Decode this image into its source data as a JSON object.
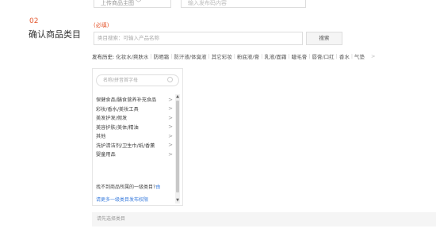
{
  "top": {
    "select_label": "上传商品主图",
    "input_placeholder": "输入发布码内容"
  },
  "step": {
    "number": "02",
    "title": "确认商品类目"
  },
  "required_tag": "(必填)",
  "category_search": {
    "placeholder": "类目搜索：可输入产品名称",
    "button_label": "搜索"
  },
  "history": {
    "label": "发布历史:",
    "items": [
      "化妆水/爽肤水",
      "防晒霜",
      "防汗液/体臭液",
      "其它彩妆",
      "粉底液/膏",
      "乳液/面霜",
      "睫毛膏",
      "唇膏/口红",
      "香水",
      "气垫"
    ],
    "more": ">"
  },
  "panel": {
    "search_placeholder": "名称/拼音首字母",
    "categories": [
      {
        "label": "保健食品/膳食营养补充食品",
        "chevron": ">"
      },
      {
        "label": "彩妆/香水/美妆工具",
        "chevron": ">"
      },
      {
        "label": "美发护发/假发",
        "chevron": ">"
      },
      {
        "label": "美容护肤/美体/精油",
        "chevron": ">"
      },
      {
        "label": "其他",
        "chevron": ">"
      },
      {
        "label": "洗护清洁剂/卫生巾/纸/香薰",
        "chevron": ">"
      },
      {
        "label": "婴童用品",
        "chevron": ">"
      }
    ],
    "not_found_text": "找不到商品所属的一级类目?",
    "not_found_link": "由",
    "apply_link": "请更多一级类目发布权限"
  },
  "selected_bar": "请先选择类目"
}
